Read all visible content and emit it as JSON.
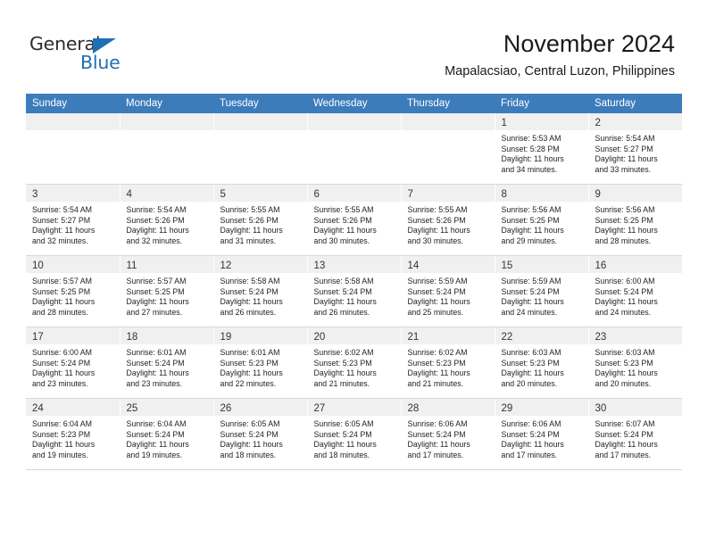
{
  "brand": {
    "word1": "General",
    "word2": "Blue",
    "accent_color": "#1f6fb5"
  },
  "header": {
    "title": "November 2024",
    "subtitle": "Mapalacsiao, Central Luzon, Philippines"
  },
  "calendar": {
    "header_bg": "#3d7cbb",
    "weekdays": [
      "Sunday",
      "Monday",
      "Tuesday",
      "Wednesday",
      "Thursday",
      "Friday",
      "Saturday"
    ],
    "weeks": [
      [
        {
          "day": "",
          "lines": []
        },
        {
          "day": "",
          "lines": []
        },
        {
          "day": "",
          "lines": []
        },
        {
          "day": "",
          "lines": []
        },
        {
          "day": "",
          "lines": []
        },
        {
          "day": "1",
          "lines": [
            "Sunrise: 5:53 AM",
            "Sunset: 5:28 PM",
            "Daylight: 11 hours",
            "and 34 minutes."
          ]
        },
        {
          "day": "2",
          "lines": [
            "Sunrise: 5:54 AM",
            "Sunset: 5:27 PM",
            "Daylight: 11 hours",
            "and 33 minutes."
          ]
        }
      ],
      [
        {
          "day": "3",
          "lines": [
            "Sunrise: 5:54 AM",
            "Sunset: 5:27 PM",
            "Daylight: 11 hours",
            "and 32 minutes."
          ]
        },
        {
          "day": "4",
          "lines": [
            "Sunrise: 5:54 AM",
            "Sunset: 5:26 PM",
            "Daylight: 11 hours",
            "and 32 minutes."
          ]
        },
        {
          "day": "5",
          "lines": [
            "Sunrise: 5:55 AM",
            "Sunset: 5:26 PM",
            "Daylight: 11 hours",
            "and 31 minutes."
          ]
        },
        {
          "day": "6",
          "lines": [
            "Sunrise: 5:55 AM",
            "Sunset: 5:26 PM",
            "Daylight: 11 hours",
            "and 30 minutes."
          ]
        },
        {
          "day": "7",
          "lines": [
            "Sunrise: 5:55 AM",
            "Sunset: 5:26 PM",
            "Daylight: 11 hours",
            "and 30 minutes."
          ]
        },
        {
          "day": "8",
          "lines": [
            "Sunrise: 5:56 AM",
            "Sunset: 5:25 PM",
            "Daylight: 11 hours",
            "and 29 minutes."
          ]
        },
        {
          "day": "9",
          "lines": [
            "Sunrise: 5:56 AM",
            "Sunset: 5:25 PM",
            "Daylight: 11 hours",
            "and 28 minutes."
          ]
        }
      ],
      [
        {
          "day": "10",
          "lines": [
            "Sunrise: 5:57 AM",
            "Sunset: 5:25 PM",
            "Daylight: 11 hours",
            "and 28 minutes."
          ]
        },
        {
          "day": "11",
          "lines": [
            "Sunrise: 5:57 AM",
            "Sunset: 5:25 PM",
            "Daylight: 11 hours",
            "and 27 minutes."
          ]
        },
        {
          "day": "12",
          "lines": [
            "Sunrise: 5:58 AM",
            "Sunset: 5:24 PM",
            "Daylight: 11 hours",
            "and 26 minutes."
          ]
        },
        {
          "day": "13",
          "lines": [
            "Sunrise: 5:58 AM",
            "Sunset: 5:24 PM",
            "Daylight: 11 hours",
            "and 26 minutes."
          ]
        },
        {
          "day": "14",
          "lines": [
            "Sunrise: 5:59 AM",
            "Sunset: 5:24 PM",
            "Daylight: 11 hours",
            "and 25 minutes."
          ]
        },
        {
          "day": "15",
          "lines": [
            "Sunrise: 5:59 AM",
            "Sunset: 5:24 PM",
            "Daylight: 11 hours",
            "and 24 minutes."
          ]
        },
        {
          "day": "16",
          "lines": [
            "Sunrise: 6:00 AM",
            "Sunset: 5:24 PM",
            "Daylight: 11 hours",
            "and 24 minutes."
          ]
        }
      ],
      [
        {
          "day": "17",
          "lines": [
            "Sunrise: 6:00 AM",
            "Sunset: 5:24 PM",
            "Daylight: 11 hours",
            "and 23 minutes."
          ]
        },
        {
          "day": "18",
          "lines": [
            "Sunrise: 6:01 AM",
            "Sunset: 5:24 PM",
            "Daylight: 11 hours",
            "and 23 minutes."
          ]
        },
        {
          "day": "19",
          "lines": [
            "Sunrise: 6:01 AM",
            "Sunset: 5:23 PM",
            "Daylight: 11 hours",
            "and 22 minutes."
          ]
        },
        {
          "day": "20",
          "lines": [
            "Sunrise: 6:02 AM",
            "Sunset: 5:23 PM",
            "Daylight: 11 hours",
            "and 21 minutes."
          ]
        },
        {
          "day": "21",
          "lines": [
            "Sunrise: 6:02 AM",
            "Sunset: 5:23 PM",
            "Daylight: 11 hours",
            "and 21 minutes."
          ]
        },
        {
          "day": "22",
          "lines": [
            "Sunrise: 6:03 AM",
            "Sunset: 5:23 PM",
            "Daylight: 11 hours",
            "and 20 minutes."
          ]
        },
        {
          "day": "23",
          "lines": [
            "Sunrise: 6:03 AM",
            "Sunset: 5:23 PM",
            "Daylight: 11 hours",
            "and 20 minutes."
          ]
        }
      ],
      [
        {
          "day": "24",
          "lines": [
            "Sunrise: 6:04 AM",
            "Sunset: 5:23 PM",
            "Daylight: 11 hours",
            "and 19 minutes."
          ]
        },
        {
          "day": "25",
          "lines": [
            "Sunrise: 6:04 AM",
            "Sunset: 5:24 PM",
            "Daylight: 11 hours",
            "and 19 minutes."
          ]
        },
        {
          "day": "26",
          "lines": [
            "Sunrise: 6:05 AM",
            "Sunset: 5:24 PM",
            "Daylight: 11 hours",
            "and 18 minutes."
          ]
        },
        {
          "day": "27",
          "lines": [
            "Sunrise: 6:05 AM",
            "Sunset: 5:24 PM",
            "Daylight: 11 hours",
            "and 18 minutes."
          ]
        },
        {
          "day": "28",
          "lines": [
            "Sunrise: 6:06 AM",
            "Sunset: 5:24 PM",
            "Daylight: 11 hours",
            "and 17 minutes."
          ]
        },
        {
          "day": "29",
          "lines": [
            "Sunrise: 6:06 AM",
            "Sunset: 5:24 PM",
            "Daylight: 11 hours",
            "and 17 minutes."
          ]
        },
        {
          "day": "30",
          "lines": [
            "Sunrise: 6:07 AM",
            "Sunset: 5:24 PM",
            "Daylight: 11 hours",
            "and 17 minutes."
          ]
        }
      ]
    ]
  }
}
